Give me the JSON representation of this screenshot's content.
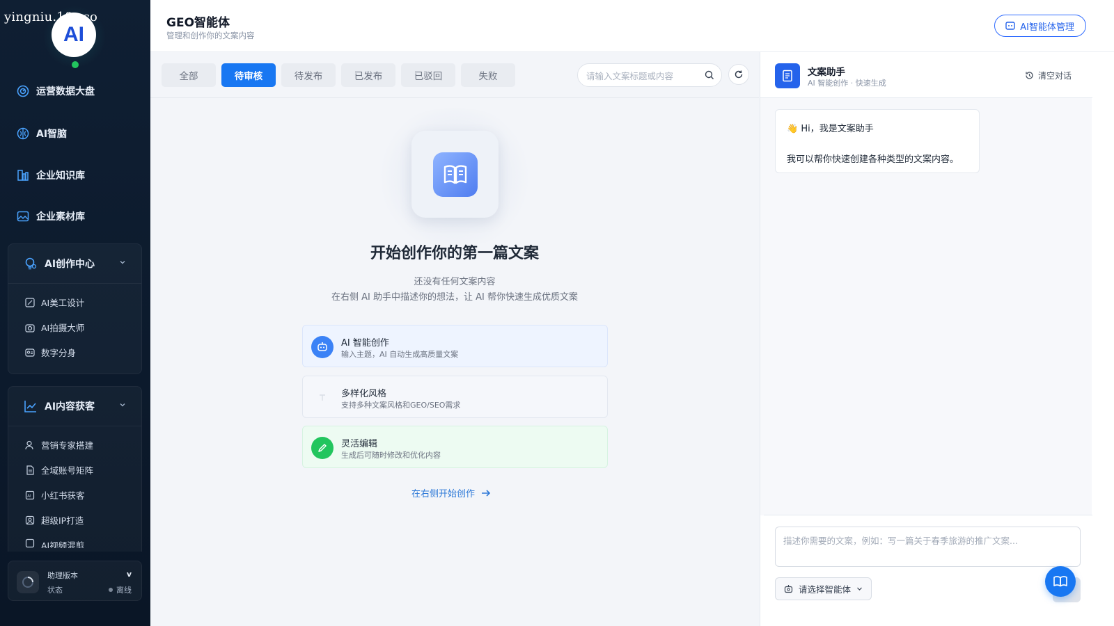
{
  "watermark": "yingniu.10v.co",
  "logo_text": "AI",
  "sidebar": {
    "items": [
      {
        "label": "运营数据大盘",
        "icon": "dashboard-icon"
      },
      {
        "label": "AI智脑",
        "icon": "brain-icon"
      },
      {
        "label": "企业知识库",
        "icon": "library-icon"
      },
      {
        "label": "企业素材库",
        "icon": "image-icon"
      }
    ],
    "groups": [
      {
        "label": "AI创作中心",
        "icon": "lightbulb-icon",
        "items": [
          {
            "label": "AI美工设计",
            "icon": "design-icon"
          },
          {
            "label": "AI拍摄大师",
            "icon": "camera-icon"
          },
          {
            "label": "数字分身",
            "icon": "id-card-icon"
          }
        ]
      },
      {
        "label": "AI内容获客",
        "icon": "trend-icon",
        "items": [
          {
            "label": "营销专家搭建",
            "icon": "user-icon"
          },
          {
            "label": "全域账号矩阵",
            "icon": "document-icon"
          },
          {
            "label": "小红书获客",
            "icon": "ai-badge-icon"
          },
          {
            "label": "超级IP打造",
            "icon": "portrait-icon"
          },
          {
            "label": "AI视频混剪",
            "icon": "video-icon"
          }
        ]
      }
    ],
    "version": {
      "label": "助理版本",
      "value": "v",
      "status_label": "状态",
      "status_value": "离线"
    }
  },
  "header": {
    "title": "GEO智能体",
    "subtitle": "管理和创作你的文案内容",
    "manage_button": "AI智能体管理"
  },
  "tabs": [
    {
      "label": "全部",
      "active": false
    },
    {
      "label": "待审核",
      "active": true
    },
    {
      "label": "待发布",
      "active": false
    },
    {
      "label": "已发布",
      "active": false
    },
    {
      "label": "已驳回",
      "active": false
    },
    {
      "label": "失败",
      "active": false
    }
  ],
  "search": {
    "placeholder": "请输入文案标题或内容"
  },
  "empty_state": {
    "title": "开始创作你的第一篇文案",
    "line1": "还没有任何文案内容",
    "line2": "在右侧 AI 助手中描述你的想法，让 AI 帮你快速生成优质文案",
    "features": [
      {
        "title": "AI 智能创作",
        "desc": "输入主题，AI 自动生成高质量文案",
        "icon": "robot-icon"
      },
      {
        "title": "多样化风格",
        "desc": "支持多种文案风格和GEO/SEO需求",
        "icon": "text-icon"
      },
      {
        "title": "灵活编辑",
        "desc": "生成后可随时修改和优化内容",
        "icon": "pencil-icon"
      }
    ],
    "cta": "在右侧开始创作"
  },
  "assistant": {
    "name": "文案助手",
    "subtitle": "AI 智能创作 · 快速生成",
    "clear_label": "清空对话",
    "greeting": "Hi，我是文案助手",
    "message": "我可以帮你快速创建各种类型的文案内容。",
    "input_placeholder": "描述你需要的文案，例如：写一篇关于春季旅游的推广文案...",
    "agent_select": "请选择智能体"
  },
  "colors": {
    "primary": "#1877f2",
    "sidebar_bg": "#0f1f33",
    "online_dot": "#22c55e",
    "feature_blue_bg": "#eef4ff",
    "feature_green_bg": "#edfbf2"
  }
}
